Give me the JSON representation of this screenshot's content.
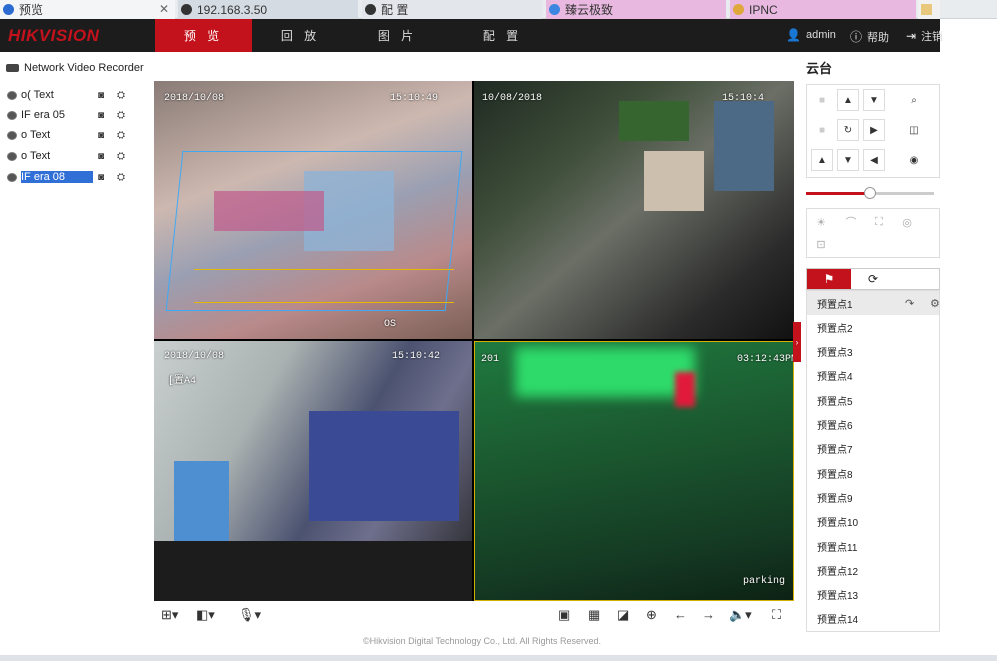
{
  "browser_tabs": [
    {
      "label": "预览",
      "close": "✕",
      "icon_color": "#2c6bd1"
    },
    {
      "label": "192.168.3.50",
      "close": "",
      "icon_color": "#333"
    },
    {
      "label": "配 置",
      "close": "",
      "icon_color": "#333"
    },
    {
      "label": "臻云极致",
      "close": "",
      "icon_color": "#3a86e0"
    },
    {
      "label": "IPNC",
      "close": "",
      "icon_color": "#e0a73a"
    }
  ],
  "header": {
    "logo": "HIKVISION",
    "nav": [
      "预 览",
      "回 放",
      "图 片",
      "配 置"
    ],
    "user": "admin",
    "help": "帮助",
    "logout": "注销"
  },
  "tree": {
    "title": "Network Video Recorder",
    "items": [
      {
        "label": "o(      Text"
      },
      {
        "label": "IF      era 05"
      },
      {
        "label": "o       Text"
      },
      {
        "label": "o       Text"
      },
      {
        "label": "IF      era 08"
      }
    ]
  },
  "video": {
    "p1": {
      "date": "2018/10/08",
      "time": "15:10:49",
      "tag": "OS"
    },
    "p2": {
      "date": "10/08/2018",
      "time": "15:10:4"
    },
    "p3": {
      "date": "2018/10/08",
      "time": "15:10:42",
      "sub": "[置A4"
    },
    "p4": {
      "date": "201",
      "time": "03:12:43PM",
      "tag": "parking"
    }
  },
  "footer": "©Hikvision Digital Technology Co., Ltd. All Rights Reserved.",
  "ptz": {
    "title": "云台"
  },
  "presets": [
    "预置点1",
    "预置点2",
    "预置点3",
    "预置点4",
    "预置点5",
    "预置点6",
    "预置点7",
    "预置点8",
    "预置点9",
    "预置点10",
    "预置点11",
    "预置点12",
    "预置点13",
    "预置点14"
  ],
  "colors": {
    "brand": "#c4121d",
    "topbar": "#1c1c1c",
    "selection": "#2f6fd6"
  }
}
